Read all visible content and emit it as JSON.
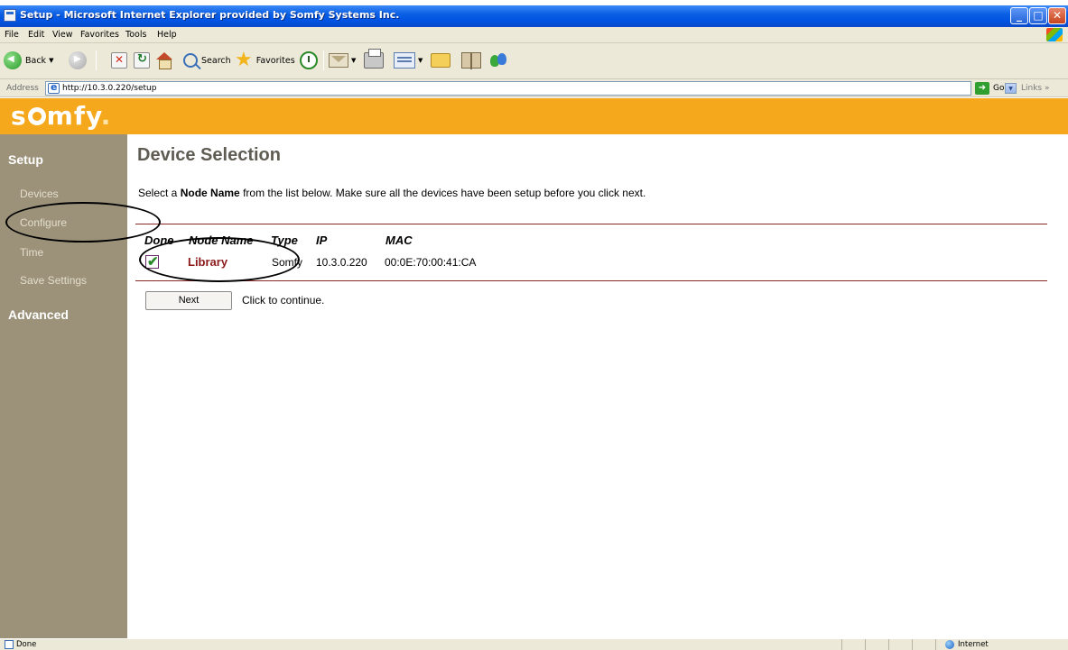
{
  "window": {
    "title": "Setup - Microsoft Internet Explorer provided by Somfy Systems Inc.",
    "minimize_glyph": "_",
    "maximize_glyph": "□",
    "close_glyph": "✕"
  },
  "menu": [
    "File",
    "Edit",
    "View",
    "Favorites",
    "Tools",
    "Help"
  ],
  "toolbar": {
    "back_label": "Back",
    "search_label": "Search",
    "favorites_label": "Favorites"
  },
  "address_bar": {
    "label": "Address",
    "url": "http://10.3.0.220/setup",
    "go_label": "Go",
    "links_label": "Links »"
  },
  "brand": {
    "logo_text_start": "s",
    "logo_text_end": "mfy",
    "logo_trailing": "."
  },
  "sidebar": {
    "sections": [
      {
        "title": "Setup",
        "items": [
          "Devices",
          "Configure",
          "Time",
          "Save Settings"
        ]
      },
      {
        "title": "Advanced",
        "items": []
      }
    ]
  },
  "main": {
    "title": "Device Selection",
    "instructions_pre": "Select a ",
    "instructions_bold": "Node Name",
    "instructions_post": " from the list below. Make sure all the devices have been setup before you click next.",
    "table": {
      "headers": [
        "Done",
        "Node Name",
        "Type",
        "IP",
        "MAC"
      ],
      "rows": [
        {
          "done": true,
          "node_name": "Library",
          "type": "Somfy",
          "ip": "10.3.0.220",
          "mac": "00:0E:70:00:41:CA"
        }
      ]
    },
    "next_button": "Next",
    "next_hint": "Click to continue."
  },
  "status_bar": {
    "text": "Done",
    "zone": "Internet"
  },
  "colors": {
    "titlebar": "#0054e3",
    "brand_orange": "#f5a81c",
    "sidebar": "#9c927a",
    "title_gray": "#5f5c54",
    "rule_red": "#8a2828",
    "link_red": "#8b1a1a"
  }
}
